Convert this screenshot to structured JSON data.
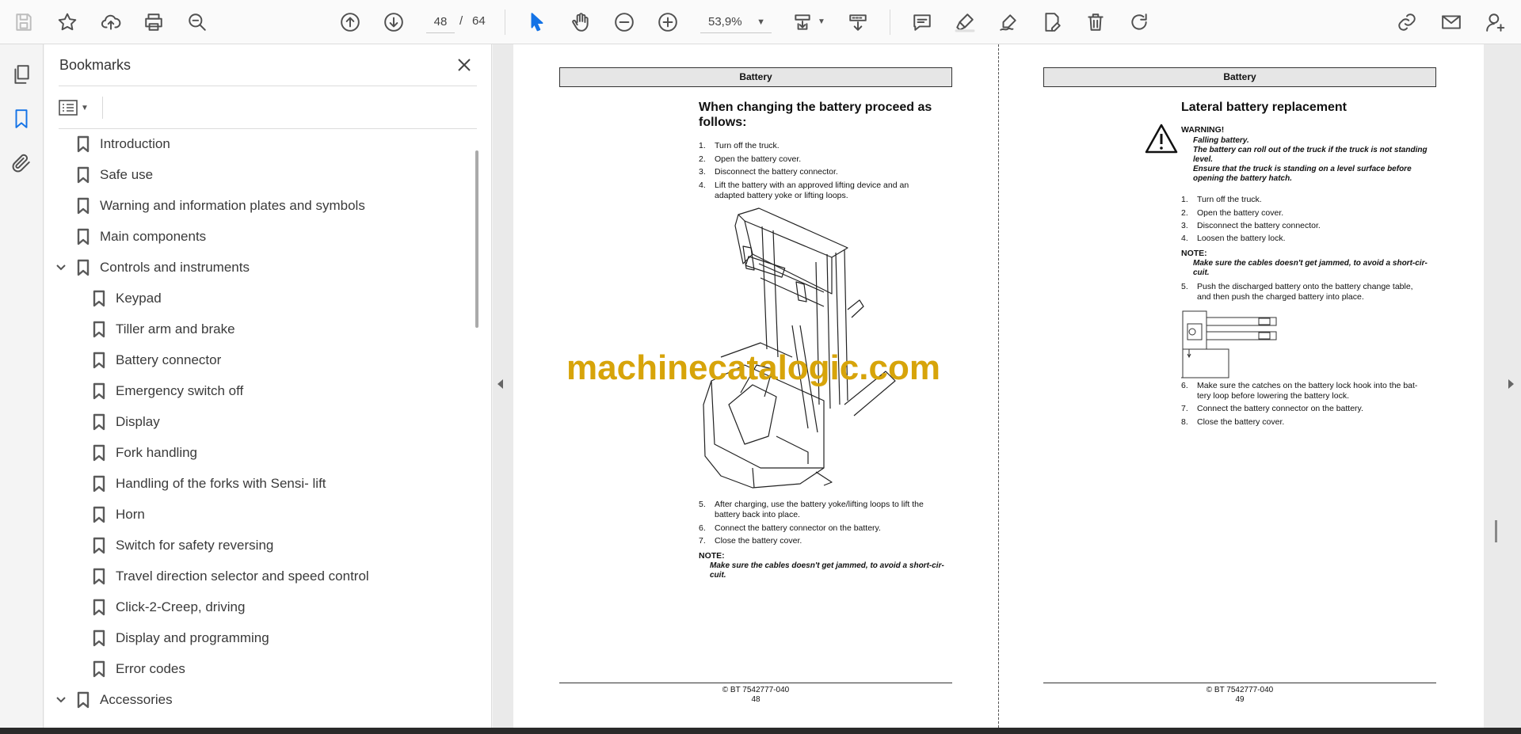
{
  "toolbar": {
    "page_current": "48",
    "page_separator": "/",
    "page_total": "64",
    "zoom": "53,9%"
  },
  "panel": {
    "title": "Bookmarks"
  },
  "bookmarks": [
    {
      "label": "Introduction",
      "level": 0,
      "expanded": null
    },
    {
      "label": "Safe use",
      "level": 0,
      "expanded": null
    },
    {
      "label": "Warning and information plates and symbols",
      "level": 0,
      "expanded": null
    },
    {
      "label": "Main components",
      "level": 0,
      "expanded": null
    },
    {
      "label": "Controls and instruments",
      "level": 0,
      "expanded": true
    },
    {
      "label": "Keypad",
      "level": 1,
      "expanded": null
    },
    {
      "label": "Tiller arm and brake",
      "level": 1,
      "expanded": null
    },
    {
      "label": "Battery connector",
      "level": 1,
      "expanded": null
    },
    {
      "label": "Emergency switch off",
      "level": 1,
      "expanded": null
    },
    {
      "label": "Display",
      "level": 1,
      "expanded": null
    },
    {
      "label": "Fork handling",
      "level": 1,
      "expanded": null
    },
    {
      "label": "Handling of the forks with Sensi- lift",
      "level": 1,
      "expanded": null
    },
    {
      "label": "Horn",
      "level": 1,
      "expanded": null
    },
    {
      "label": "Switch for safety reversing",
      "level": 1,
      "expanded": null
    },
    {
      "label": "Travel direction selector and speed control",
      "level": 1,
      "expanded": null
    },
    {
      "label": "Click-2-Creep, driving",
      "level": 1,
      "expanded": null
    },
    {
      "label": "Display and programming",
      "level": 1,
      "expanded": null
    },
    {
      "label": "Error codes",
      "level": 1,
      "expanded": null
    },
    {
      "label": "Accessories",
      "level": 0,
      "expanded": true
    }
  ],
  "page_left": {
    "header": "Battery",
    "title_l1": "When changing the battery proceed as",
    "title_l2": "follows:",
    "steps_a": [
      {
        "n": "1.",
        "t": "Turn off the truck."
      },
      {
        "n": "2.",
        "t": "Open the battery cover."
      },
      {
        "n": "3.",
        "t": "Disconnect the battery connector."
      },
      {
        "n": "4.",
        "t": "Lift the battery with an approved lifting device and an",
        "t2": "adapted battery yoke or lifting loops."
      }
    ],
    "steps_b": [
      {
        "n": "5.",
        "t": "After charging, use the battery yoke/lifting loops to lift the",
        "t2": "battery back into place."
      },
      {
        "n": "6.",
        "t": "Connect the battery connector on the battery."
      },
      {
        "n": "7.",
        "t": "Close the battery cover."
      }
    ],
    "note_label": "NOTE:",
    "note_l1": "Make sure the cables doesn't get jammed, to avoid a short-cir-",
    "note_l2": "cuit.",
    "footer_l1": "© BT 7542777-040",
    "footer_l2": "48"
  },
  "page_right": {
    "header": "Battery",
    "title": "Lateral battery replacement",
    "warning_label": "WARNING!",
    "warning_l1": "Falling battery.",
    "warning_l2": "The battery can roll out of the truck if the truck is not standing",
    "warning_l3": "level.",
    "warning_l4": "Ensure that the truck is standing on a level surface before",
    "warning_l5": "opening the battery hatch.",
    "steps_a": [
      {
        "n": "1.",
        "t": "Turn off the truck."
      },
      {
        "n": "2.",
        "t": "Open the battery cover."
      },
      {
        "n": "3.",
        "t": "Disconnect the battery connector."
      },
      {
        "n": "4.",
        "t": "Loosen the battery lock."
      }
    ],
    "note_label": "NOTE:",
    "note_l1": "Make sure the cables doesn't get jammed, to avoid a short-cir-",
    "note_l2": "cuit.",
    "step5_n": "5.",
    "step5_t1": "Push the discharged battery onto the battery change table,",
    "step5_t2": "and then push the charged battery into place.",
    "steps_b": [
      {
        "n": "6.",
        "t": "Make sure the catches on the battery lock hook into the bat-",
        "t2": "tery loop before lowering the battery lock."
      },
      {
        "n": "7.",
        "t": "Connect the battery connector on the battery."
      },
      {
        "n": "8.",
        "t": "Close the battery cover."
      }
    ],
    "footer_l1": "© BT 7542777-040",
    "footer_l2": "49"
  },
  "watermark": "machinecatalogic.com",
  "colors": {
    "accent": "#1473e6",
    "watermark": "#d7a40a"
  },
  "icons": {
    "toolbar": [
      "save-icon",
      "star-icon",
      "upload-icon",
      "print-icon",
      "zoom-search-icon",
      "page-up-icon",
      "page-down-icon",
      "select-cursor-icon",
      "hand-icon",
      "zoom-out-icon",
      "zoom-in-icon",
      "fit-page-icon",
      "scroll-mode-icon",
      "comment-icon",
      "highlight-icon",
      "sign-icon",
      "edit-pdf-icon",
      "delete-icon",
      "rotate-icon",
      "share-link-icon",
      "email-icon",
      "account-icon"
    ]
  }
}
